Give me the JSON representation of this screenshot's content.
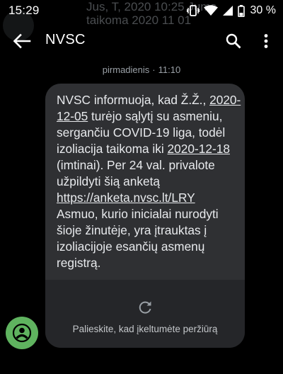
{
  "status_bar": {
    "time": "15:29",
    "battery_percent": "30 %",
    "background_notification_lines": [
      "Jus, T, 2020 10:25 Jums",
      "taikoma 2020 11 01"
    ]
  },
  "app_bar": {
    "title": "NVSC",
    "back_icon": "arrow-left-icon",
    "search_icon": "search-icon",
    "more_icon": "more-vert-icon"
  },
  "conversation": {
    "date_day": "pirmadienis",
    "date_time": "11:10",
    "message": {
      "p1": "NVSC informuoja, kad Ž.Ž., ",
      "date1": "2020-12-05",
      "p2": " turėjo sąlytį su asmeniu, sergančiu COVID-19 liga, todėl izoliacija taikoma iki ",
      "date2": "2020-12-18",
      "p3": " (imtinai). Per 24 val. privalote užpildyti šią anketą ",
      "link": "https://anketa.nvsc.lt/LRY",
      "p4": "\nAsmuo, kurio inicialai nurodyti šioje žinutėje, yra įtrauktas į izoliacijoje esančių asmenų registrą."
    },
    "link_preview": {
      "label": "Palieskite, kad įkeltumėte peržiūrą",
      "icon": "refresh-icon"
    },
    "contact_avatar_icon": "person-icon",
    "avatar_color": "#5fb35f"
  }
}
